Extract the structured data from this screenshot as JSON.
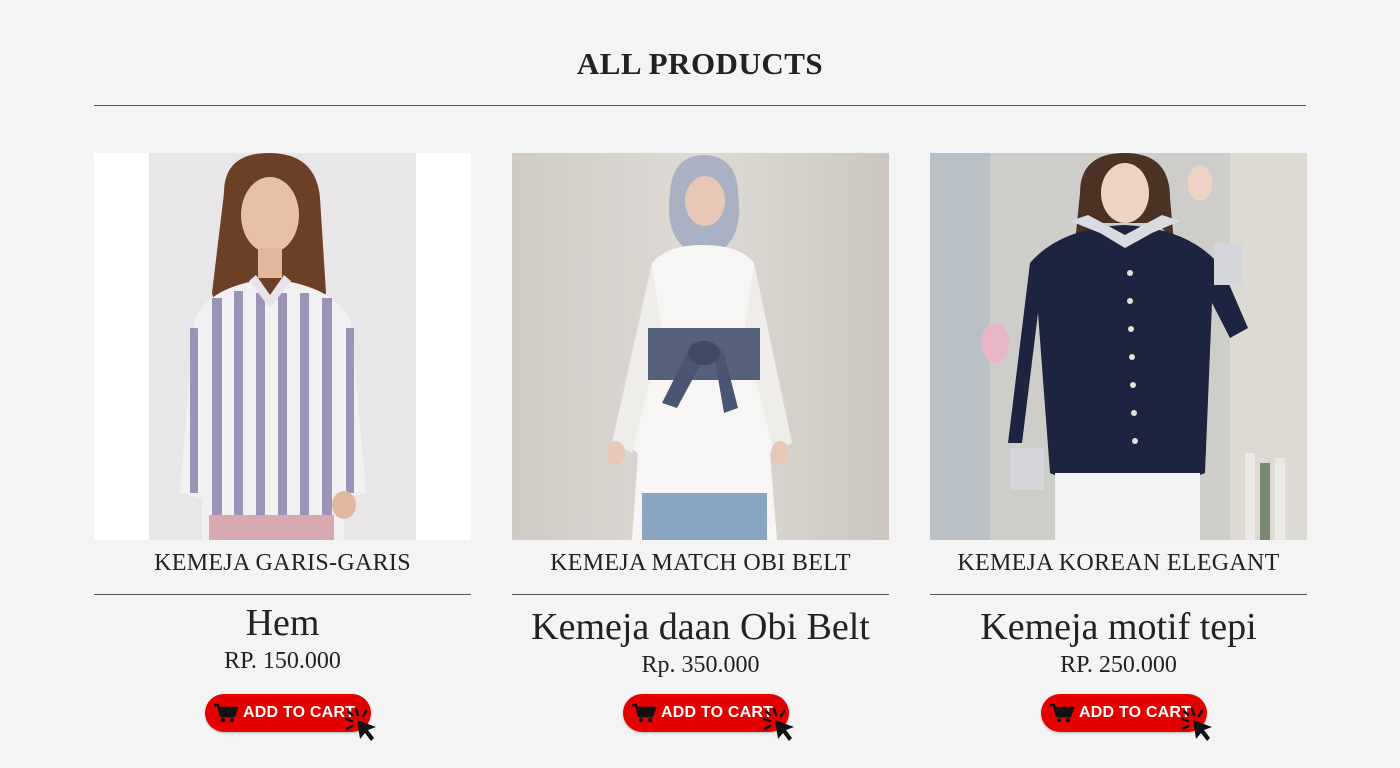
{
  "header": {
    "title": "ALL PRODUCTS"
  },
  "products": [
    {
      "label": "KEMEJA GARIS-GARIS",
      "name": "Hem",
      "price": "RP. 150.000",
      "image_alt": "Woman wearing a lavender and white striped shirt",
      "cart_label": "ADD TO CART"
    },
    {
      "label": "KEMEJA MATCH OBI BELT",
      "name": "Kemeja daan Obi Belt",
      "price": "Rp. 350.000",
      "image_alt": "Woman in hijab wearing a white shirt with denim obi belt",
      "cart_label": "ADD TO CART"
    },
    {
      "label": "KEMEJA KOREAN ELEGANT",
      "name": "Kemeja motif tepi",
      "price": "RP. 250.000",
      "image_alt": "Woman wearing a navy shirt with patterned collar and cuffs",
      "cart_label": "ADD TO CART"
    }
  ],
  "icons": {
    "cart": "shopping-cart-icon",
    "cursor": "click-cursor-icon"
  },
  "colors": {
    "background": "#f4f4f4",
    "cart_button": "#e40000",
    "text": "#222222"
  }
}
